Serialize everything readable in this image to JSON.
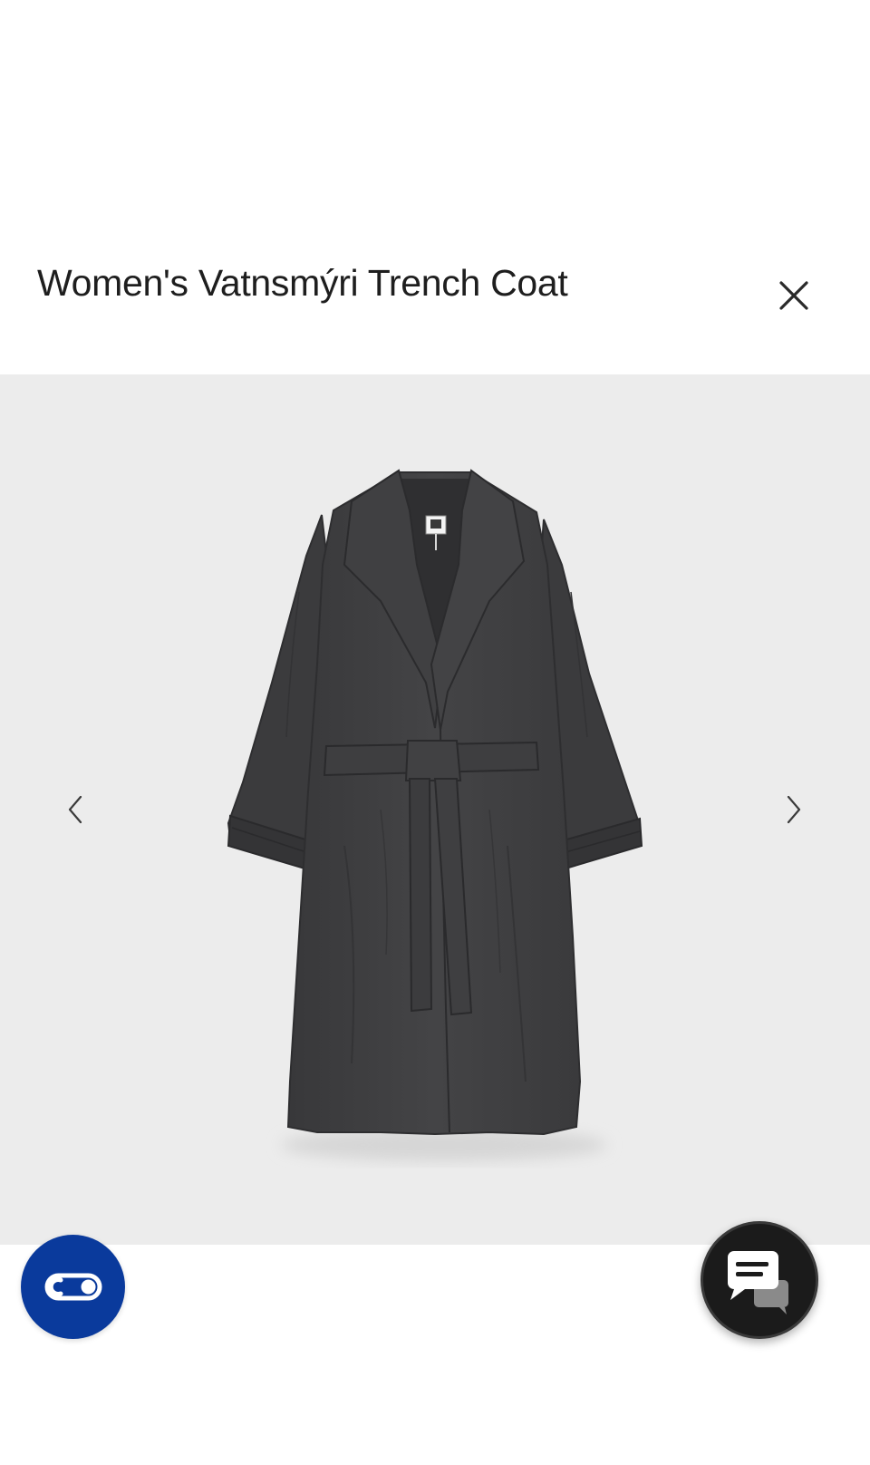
{
  "product": {
    "title": "Women's Vatnsmýri Trench Coat"
  },
  "gallery": {
    "image_subject": "dark grey belted trench coat with notched lapels",
    "coat_color": "#3f3f41",
    "background_color": "#ececec"
  },
  "icons": {
    "close": "close-icon",
    "previous": "chevron-left-icon",
    "next": "chevron-right-icon",
    "accessibility": "accessibility-toggle-icon",
    "chat": "chat-bubbles-icon",
    "brand_label": "brand-label-logo"
  },
  "colors": {
    "accessibility_button": "#0a3a9c",
    "chat_button": "#1b1b1b",
    "text": "#1e1e1e"
  }
}
